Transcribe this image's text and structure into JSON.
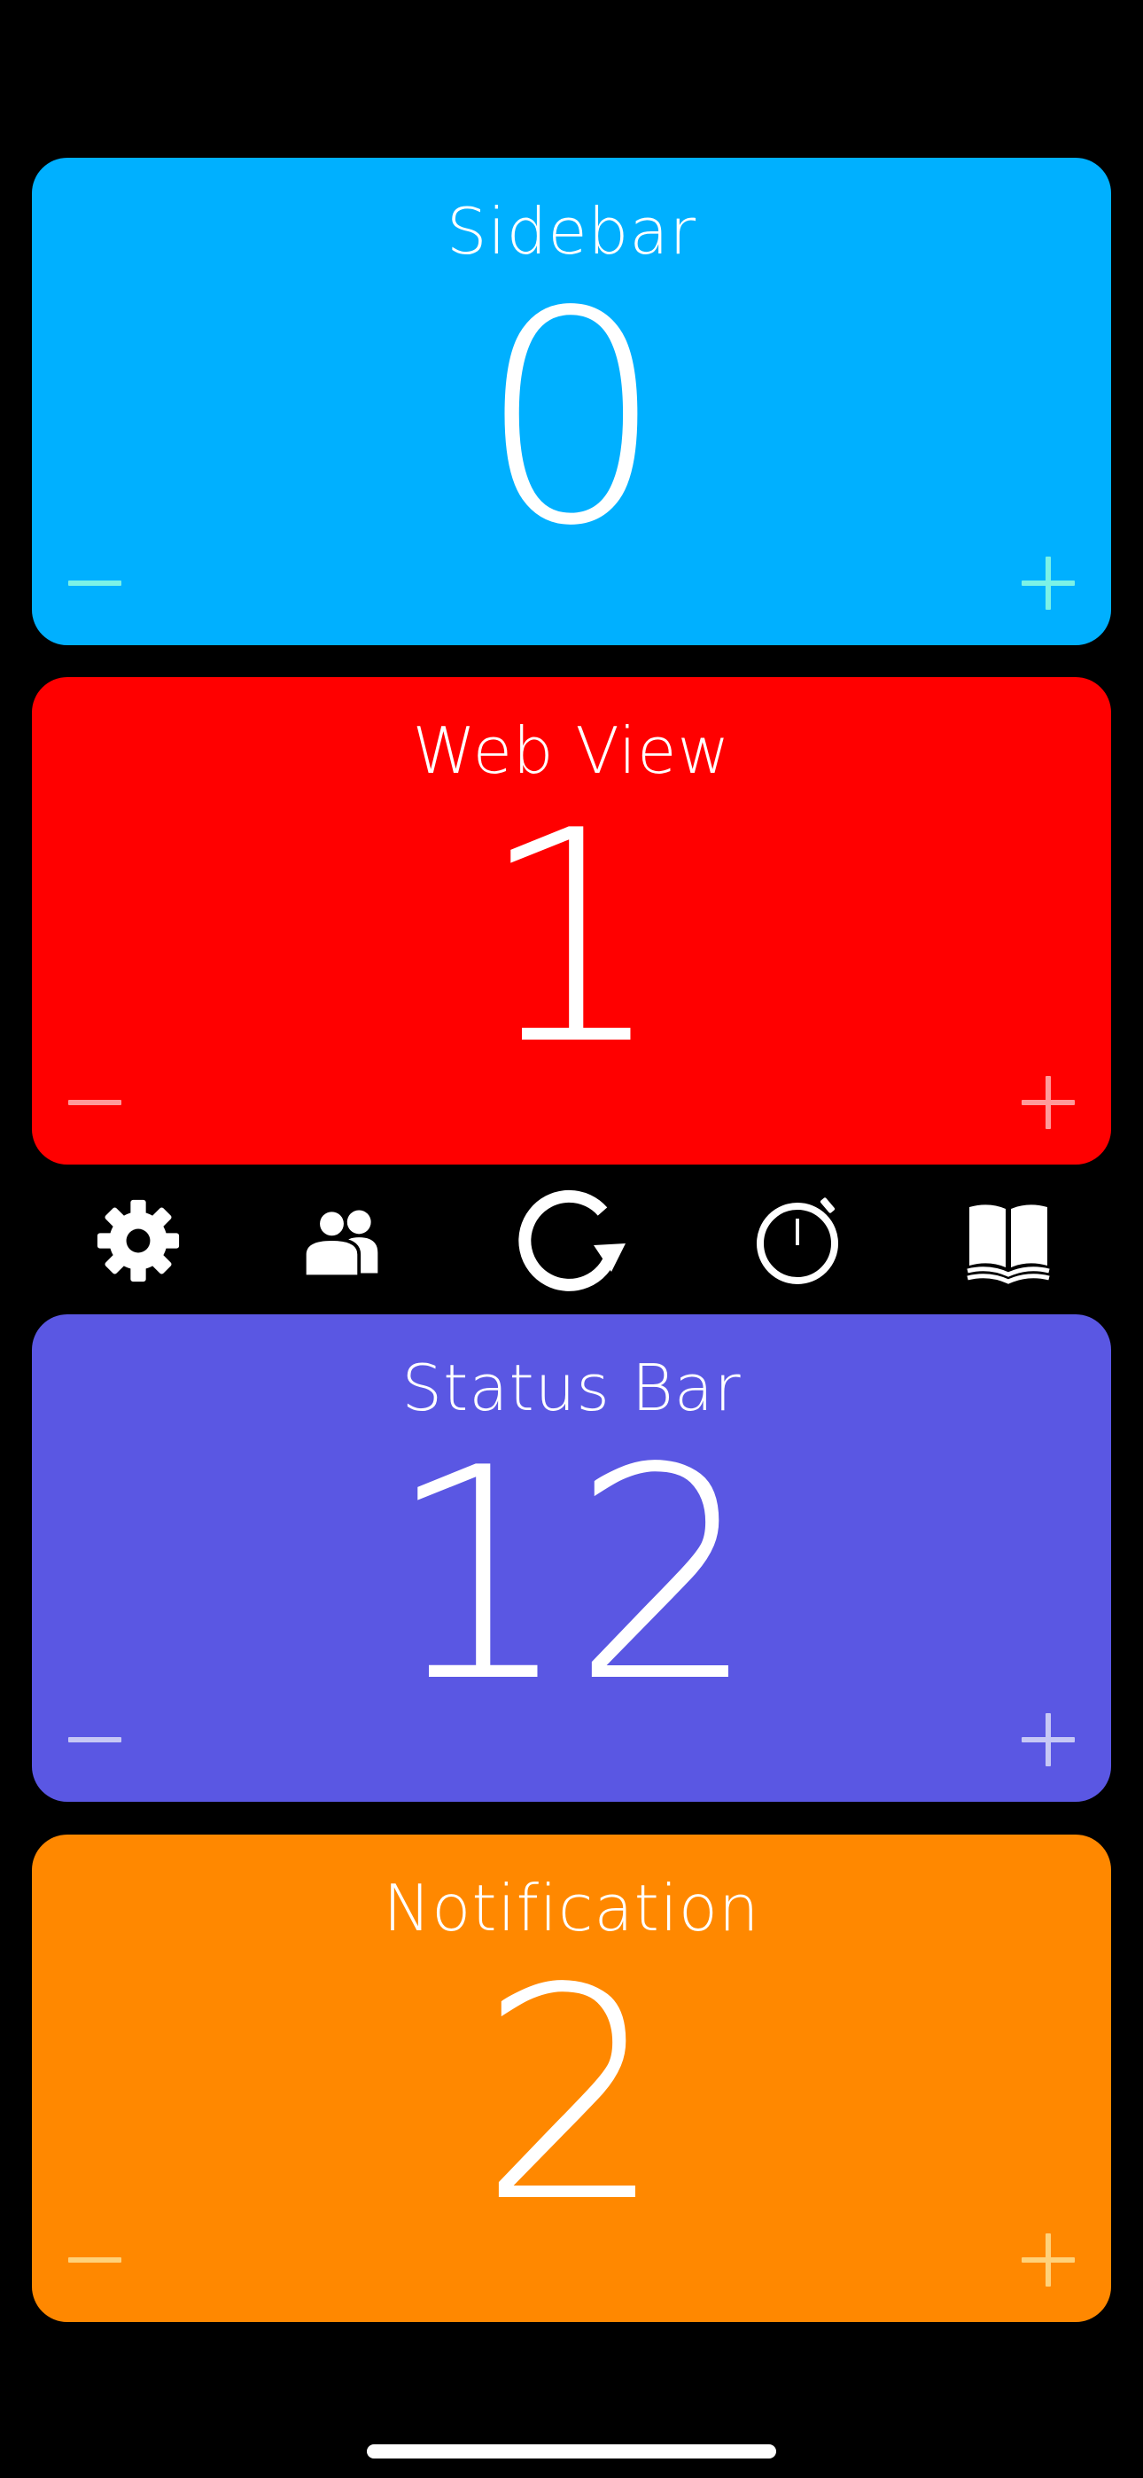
{
  "colors": {
    "background": "#000000",
    "sidebar": "#00B0FF",
    "web_view": "#FF0000",
    "status_bar": "#5A57E3",
    "notification": "#FF8800",
    "text": "#FFFFFF"
  },
  "counters": [
    {
      "label": "Sidebar",
      "value": "0",
      "color": "#00B0FF",
      "stepper_color": "#7CF2E6",
      "decrement_icon": "minus-icon",
      "increment_icon": "plus-icon"
    },
    {
      "label": "Web View",
      "value": "1",
      "color": "#FF0000",
      "stepper_color": "#FF9A9A",
      "decrement_icon": "minus-icon",
      "increment_icon": "plus-icon"
    },
    {
      "label": "Status Bar",
      "value": "12",
      "color": "#5A57E3",
      "stepper_color": "#C7C8F5",
      "decrement_icon": "minus-icon",
      "increment_icon": "plus-icon"
    },
    {
      "label": "Notification",
      "value": "2",
      "color": "#FF8800",
      "stepper_color": "#FFD27A",
      "decrement_icon": "minus-icon",
      "increment_icon": "plus-icon"
    }
  ],
  "toolbar": {
    "icons": [
      "gear-icon",
      "people-icon",
      "reset-icon",
      "stopwatch-icon",
      "book-icon"
    ]
  }
}
